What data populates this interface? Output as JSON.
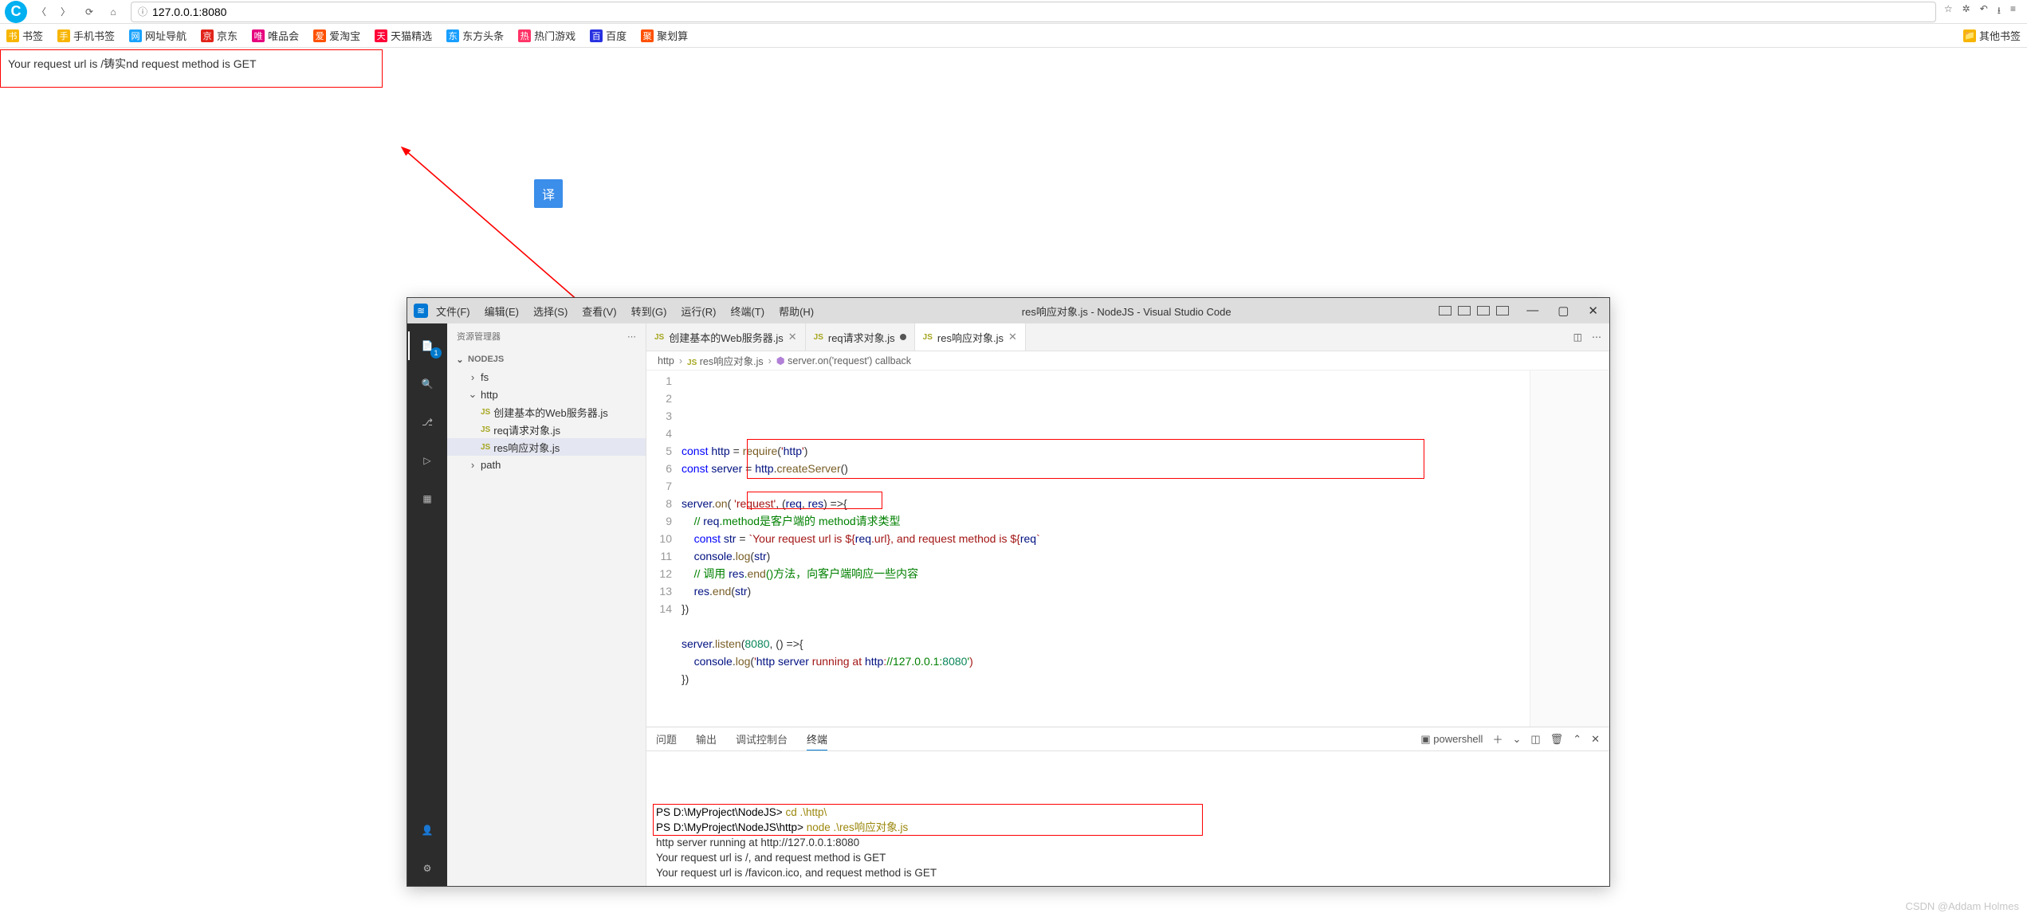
{
  "browser": {
    "url": "127.0.0.1:8080",
    "bookmarks": [
      {
        "label": "书签",
        "color": "#f7b500"
      },
      {
        "label": "手机书签",
        "color": "#f7b500"
      },
      {
        "label": "网址导航",
        "color": "#19a3ff"
      },
      {
        "label": "京东",
        "color": "#e1251b"
      },
      {
        "label": "唯品会",
        "color": "#e6007e"
      },
      {
        "label": "爱淘宝",
        "color": "#ff5000"
      },
      {
        "label": "天猫精选",
        "color": "#ff0036"
      },
      {
        "label": "东方头条",
        "color": "#199fff"
      },
      {
        "label": "热门游戏",
        "color": "#f36"
      },
      {
        "label": "百度",
        "color": "#2932e1"
      },
      {
        "label": "聚划算",
        "color": "#ff5000"
      }
    ],
    "other_bookmarks": "其他书签"
  },
  "page_text": "Your request url is /铸实nd request method is GET",
  "translate_label": "译",
  "vscode": {
    "menu": [
      "文件(F)",
      "编辑(E)",
      "选择(S)",
      "查看(V)",
      "转到(G)",
      "运行(R)",
      "终端(T)",
      "帮助(H)"
    ],
    "title": "res响应对象.js - NodeJS - Visual Studio Code",
    "explorer_title": "资源管理器",
    "tree_root": "NODEJS",
    "tree": [
      {
        "type": "folder",
        "label": "fs",
        "open": false,
        "depth": 1
      },
      {
        "type": "folder",
        "label": "http",
        "open": true,
        "depth": 1
      },
      {
        "type": "file",
        "label": "创建基本的Web服务器.js",
        "depth": 2
      },
      {
        "type": "file",
        "label": "req请求对象.js",
        "depth": 2
      },
      {
        "type": "file",
        "label": "res响应对象.js",
        "depth": 2,
        "selected": true
      },
      {
        "type": "folder",
        "label": "path",
        "open": false,
        "depth": 1
      }
    ],
    "tabs": [
      {
        "label": "创建基本的Web服务器.js",
        "active": false,
        "dirty": false
      },
      {
        "label": "req请求对象.js",
        "active": false,
        "dirty": true
      },
      {
        "label": "res响应对象.js",
        "active": true,
        "dirty": false
      }
    ],
    "breadcrumb": [
      "http",
      "res响应对象.js",
      "server.on('request') callback"
    ],
    "code": {
      "lines": [
        "const http = require('http')",
        "const server = http.createServer()",
        "",
        "server.on( 'request', (req, res) =>{",
        "    // req.method是客户端的 method请求类型",
        "    const str = `Your request url is ${req.url}, and request method is ${req",
        "    console.log(str)",
        "    // 调用 res.end()方法，向客户端响应一些内容",
        "    res.end(str)",
        "})",
        "",
        "server.listen(8080, () =>{",
        "    console.log('http server running at http://127.0.0.1:8080')",
        "})"
      ]
    },
    "panel": {
      "tabs": [
        "问题",
        "输出",
        "调试控制台",
        "终端"
      ],
      "active_tab": "终端",
      "shell_label": "powershell",
      "terminal_lines": [
        "PS D:\\MyProject\\NodeJS> cd .\\http\\",
        "PS D:\\MyProject\\NodeJS\\http> node .\\res响应对象.js",
        "http server running at http://127.0.0.1:8080",
        "Your request url is /, and request method is GET",
        "Your request url is /favicon.ico, and request method is GET"
      ]
    }
  },
  "watermark": "CSDN @Addam Holmes"
}
